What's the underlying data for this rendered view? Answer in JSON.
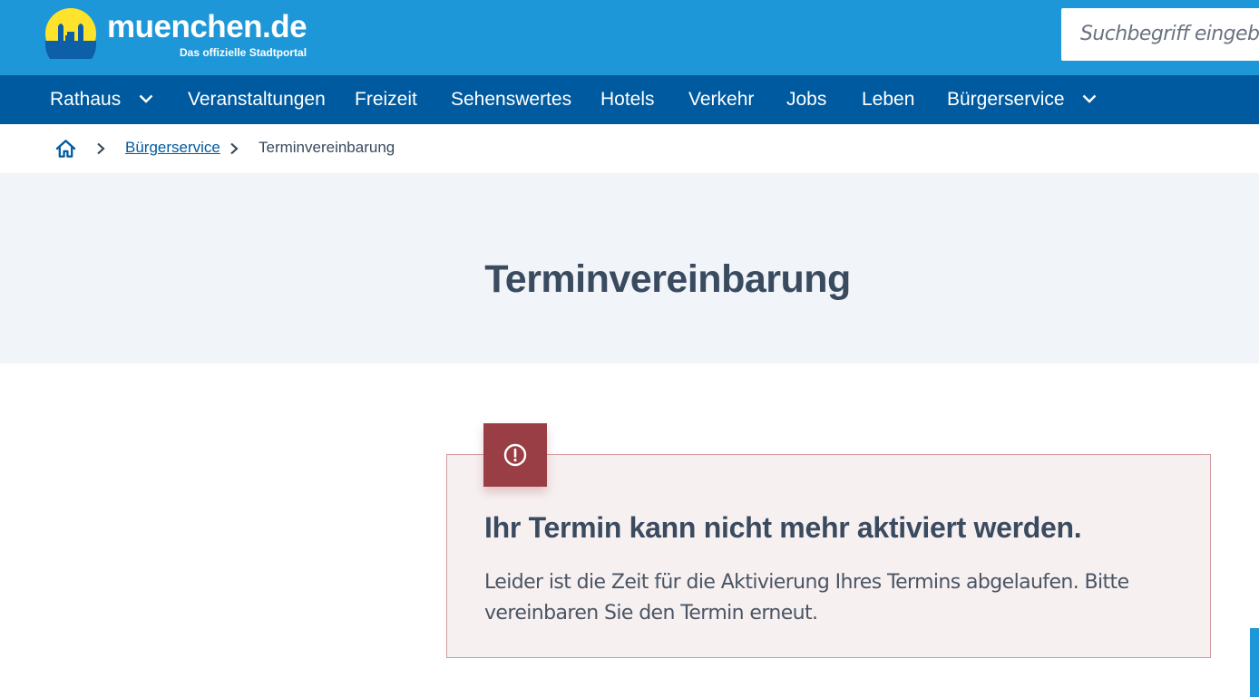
{
  "header": {
    "logo_wordmark": "muenchen.de",
    "logo_tagline": "Das offizielle Stadtportal",
    "search_placeholder": "Suchbegriff eingeben"
  },
  "nav": {
    "items": [
      {
        "label": "Rathaus",
        "has_dropdown": true
      },
      {
        "label": "Veranstaltungen",
        "has_dropdown": false
      },
      {
        "label": "Freizeit",
        "has_dropdown": false
      },
      {
        "label": "Sehenswertes",
        "has_dropdown": false
      },
      {
        "label": "Hotels",
        "has_dropdown": false
      },
      {
        "label": "Verkehr",
        "has_dropdown": false
      },
      {
        "label": "Jobs",
        "has_dropdown": false
      },
      {
        "label": "Leben",
        "has_dropdown": false
      },
      {
        "label": "Bürgerservice",
        "has_dropdown": true
      }
    ]
  },
  "breadcrumb": {
    "home_icon": "home-icon",
    "link": "Bürgerservice",
    "current": "Terminvereinbarung"
  },
  "hero": {
    "title": "Terminvereinbarung"
  },
  "alert": {
    "icon": "exclamation-circle-icon",
    "heading": "Ihr Termin kann nicht mehr aktiviert werden.",
    "body": "Leider ist die Zeit für die Aktivierung Ihres Termins abgelaufen. Bitte vereinbaren Sie den Termin erneut."
  },
  "colors": {
    "header_blue": "#1d97d7",
    "nav_blue": "#005a9f",
    "hero_bg": "#f1f4f9",
    "alert_bg": "#f7f0f1",
    "alert_border": "#d19a9d",
    "alert_badge": "#9a3e45",
    "logo_yellow": "#ffe22b"
  }
}
